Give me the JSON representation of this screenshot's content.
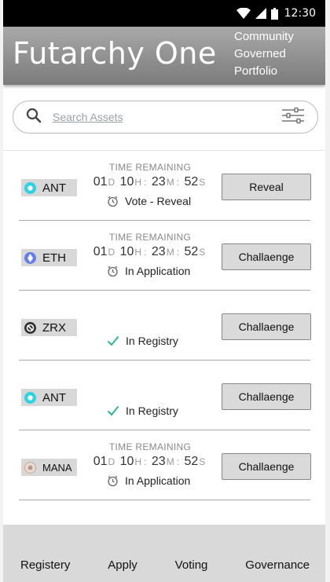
{
  "status_bar": {
    "time": "12:30"
  },
  "header": {
    "title": "Futarchy One",
    "subtitle": "Community Governed Portfolio"
  },
  "search": {
    "placeholder": "Search Assets"
  },
  "assets": [
    {
      "symbol": "ANT",
      "icon": "ant-icon",
      "show_timer": true,
      "timer_label": "TIME REMAINING",
      "days": "01",
      "hours": "10",
      "minutes": "23",
      "seconds": "52",
      "unit_d": "D",
      "unit_h": "H",
      "unit_m": "M",
      "unit_s": "S",
      "status": "Vote - Reveal",
      "status_icon": "clock-icon",
      "action": "Reveal"
    },
    {
      "symbol": "ETH",
      "icon": "eth-icon",
      "show_timer": true,
      "timer_label": "TIME REMAINING",
      "days": "01",
      "hours": "10",
      "minutes": "23",
      "seconds": "52",
      "unit_d": "D",
      "unit_h": "H",
      "unit_m": "M",
      "unit_s": "S",
      "status": "In Application",
      "status_icon": "clock-icon",
      "action": "Challaenge"
    },
    {
      "symbol": "ZRX",
      "icon": "zrx-icon",
      "show_timer": false,
      "status": "In Registry",
      "status_icon": "check-icon",
      "action": "Challaenge"
    },
    {
      "symbol": "ANT",
      "icon": "ant-icon",
      "show_timer": false,
      "status": "In Registry",
      "status_icon": "check-icon",
      "action": "Challaenge"
    },
    {
      "symbol": "MANA",
      "icon": "mana-icon",
      "show_timer": true,
      "timer_label": "TIME REMAINING",
      "days": "01",
      "hours": "10",
      "minutes": "23",
      "seconds": "52",
      "unit_d": "D",
      "unit_h": "H",
      "unit_m": "M",
      "unit_s": "S",
      "status": "In Application",
      "status_icon": "clock-icon",
      "action": "Challaenge"
    }
  ],
  "bottom_nav": [
    {
      "label": "Registery"
    },
    {
      "label": "Apply"
    },
    {
      "label": "Voting"
    },
    {
      "label": "Governance"
    }
  ],
  "colors": {
    "header_top": "#a9a9a9",
    "header_bottom": "#7b7b7b",
    "ant": "#2cd3e1",
    "eth": "#627eea",
    "zrx": "#333333",
    "mana": "#d9b8a8",
    "check": "#2bb59a"
  }
}
